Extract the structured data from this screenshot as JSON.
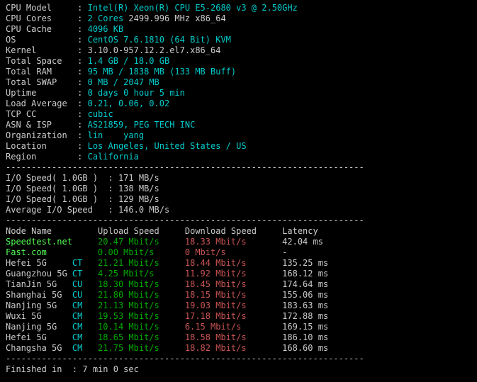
{
  "info": {
    "cpu_model_label": "CPU Model",
    "cpu_model_value": "Intel(R) Xeon(R) CPU E5-2680 v3 @ 2.50GHz",
    "cpu_cores_label": "CPU Cores",
    "cpu_cores_count": "2 Cores",
    "cpu_cores_freq": " 2499.996 MHz x86_64",
    "cpu_cache_label": "CPU Cache",
    "cpu_cache_value": "4096 KB",
    "os_label": "OS",
    "os_value": "CentOS 7.6.1810 (64 Bit) KVM",
    "kernel_label": "Kernel",
    "kernel_value": "3.10.0-957.12.2.el7.x86_64",
    "total_space_label": "Total Space",
    "total_space_value": "1.4 GB / 18.0 GB",
    "total_ram_label": "Total RAM",
    "total_ram_value": "95 MB / 1838 MB (133 MB Buff)",
    "total_swap_label": "Total SWAP",
    "total_swap_value": "0 MB / 2047 MB",
    "uptime_label": "Uptime",
    "uptime_value": "0 days 0 hour 5 min",
    "load_label": "Load Average",
    "load_value": "0.21, 0.06, 0.02",
    "tcp_label": "TCP CC",
    "tcp_value": "cubic",
    "asn_label": "ASN & ISP",
    "asn_value": "AS21859, PEG TECH INC",
    "org_label": "Organization",
    "org_value": "lin    yang",
    "loc_label": "Location",
    "loc_value": "Los Angeles, United States / US",
    "region_label": "Region",
    "region_value": "California"
  },
  "io": {
    "r1_label": "I/O Speed( 1.0GB )",
    "r1_value": "171 MB/s",
    "r2_label": "I/O Speed( 1.0GB )",
    "r2_value": "138 MB/s",
    "r3_label": "I/O Speed( 1.0GB )",
    "r3_value": "129 MB/s",
    "avg_label": "Average I/O Speed",
    "avg_value": "146.0 MB/s"
  },
  "speed_header": {
    "node": "Node Name",
    "up": "Upload Speed",
    "down": "Download Speed",
    "lat": "Latency"
  },
  "speed": [
    {
      "node": "Speedtest.net",
      "tag": "",
      "up": "20.47 Mbit/s",
      "down": "18.33 Mbit/s",
      "lat": "42.04 ms",
      "node_green": true
    },
    {
      "node": "Fast.com",
      "tag": "",
      "up": "0.00 Mbit/s",
      "down": "0 Mbit/s",
      "lat": "-",
      "node_green": true
    },
    {
      "node": "Hefei 5G",
      "tag": "CT",
      "up": "21.21 Mbit/s",
      "down": "18.44 Mbit/s",
      "lat": "135.25 ms",
      "node_green": false
    },
    {
      "node": "Guangzhou 5G",
      "tag": "CT",
      "up": "4.25 Mbit/s",
      "down": "11.92 Mbit/s",
      "lat": "168.12 ms",
      "node_green": false
    },
    {
      "node": "TianJin 5G",
      "tag": "CU",
      "up": "18.30 Mbit/s",
      "down": "18.45 Mbit/s",
      "lat": "174.64 ms",
      "node_green": false
    },
    {
      "node": "Shanghai 5G",
      "tag": "CU",
      "up": "21.80 Mbit/s",
      "down": "18.15 Mbit/s",
      "lat": "155.06 ms",
      "node_green": false
    },
    {
      "node": "Nanjing 5G",
      "tag": "CM",
      "up": "21.13 Mbit/s",
      "down": "19.03 Mbit/s",
      "lat": "183.63 ms",
      "node_green": false
    },
    {
      "node": "Wuxi 5G",
      "tag": "CM",
      "up": "19.53 Mbit/s",
      "down": "17.18 Mbit/s",
      "lat": "172.88 ms",
      "node_green": false
    },
    {
      "node": "Nanjing 5G",
      "tag": "CM",
      "up": "10.14 Mbit/s",
      "down": "6.15 Mbit/s",
      "lat": "169.15 ms",
      "node_green": false
    },
    {
      "node": "Hefei 5G",
      "tag": "CM",
      "up": "18.65 Mbit/s",
      "down": "18.58 Mbit/s",
      "lat": "186.10 ms",
      "node_green": false
    },
    {
      "node": "Changsha 5G",
      "tag": "CM",
      "up": "21.75 Mbit/s",
      "down": "18.82 Mbit/s",
      "lat": "168.60 ms",
      "node_green": false
    }
  ],
  "footer": {
    "finished_label": "Finished in",
    "finished_value": "7 min 0 sec"
  },
  "divider": "----------------------------------------------------------------------"
}
